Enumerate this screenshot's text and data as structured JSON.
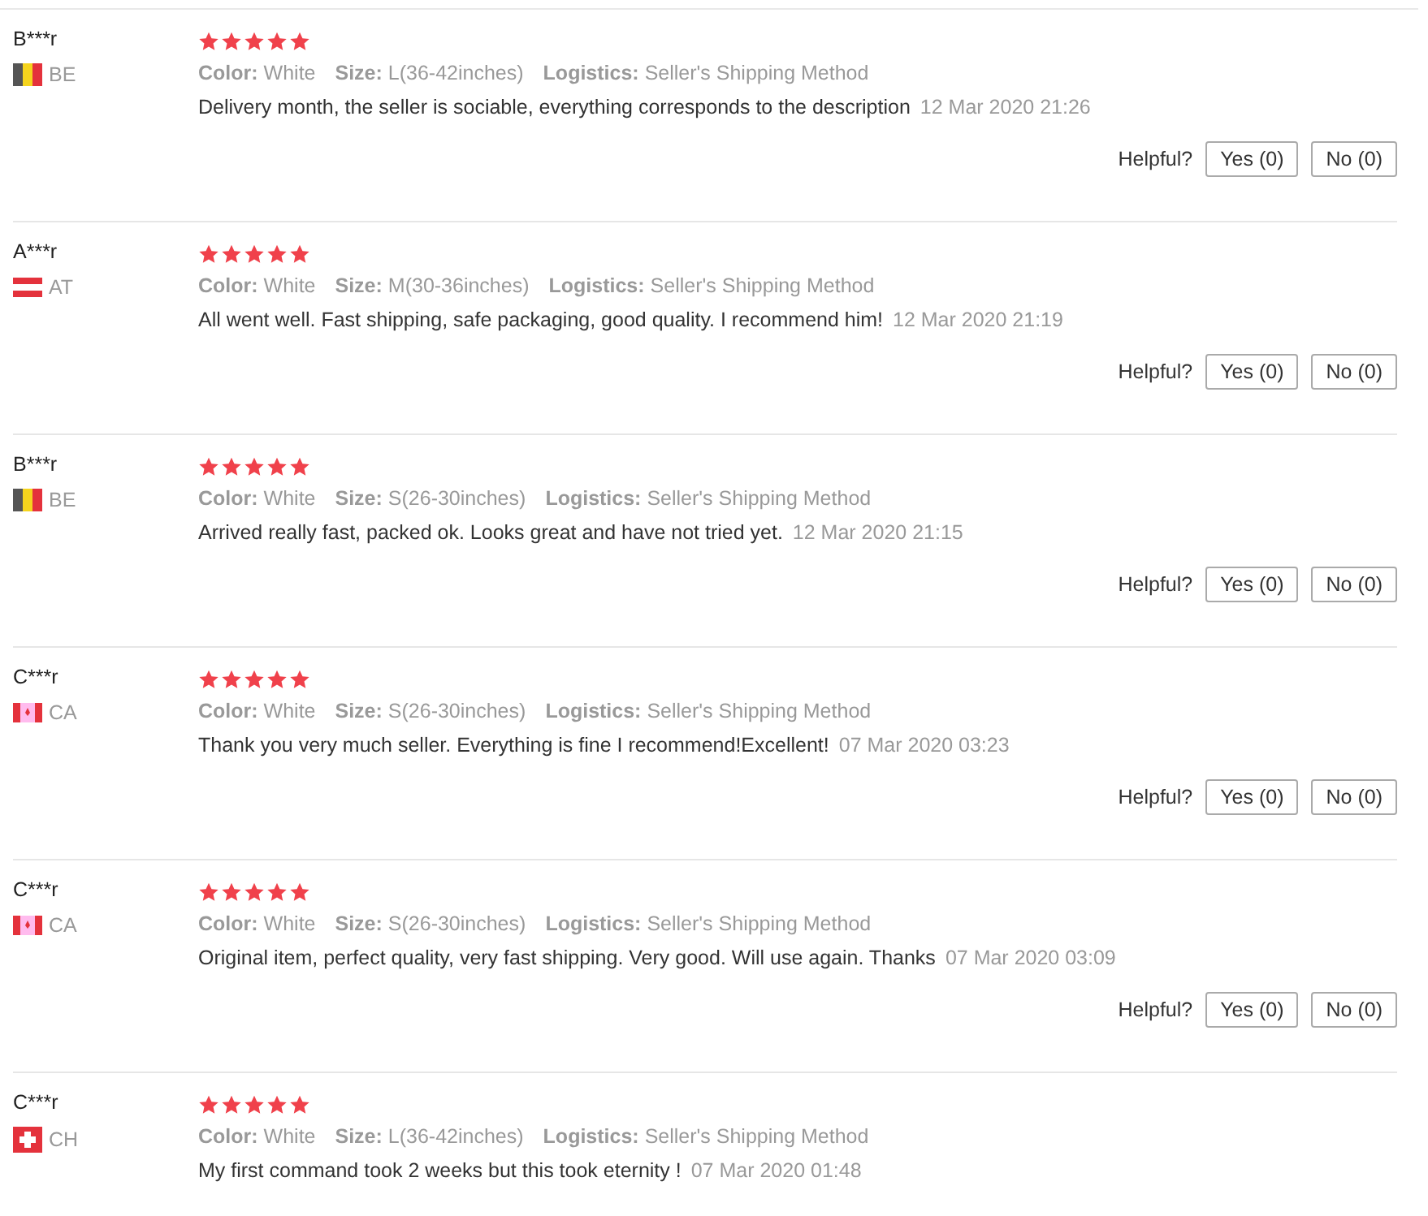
{
  "reviews": [
    {
      "user": "B***r",
      "country": {
        "code": "BE",
        "kind": "belgium"
      },
      "stars": 5,
      "color_label": "Color:",
      "color_value": "White",
      "size_label": "Size:",
      "size": "L(36-42inches)",
      "logistics_label": "Logistics:",
      "logistics": "Seller's Shipping Method",
      "text": "Delivery month, the seller is sociable, everything corresponds to the description",
      "date": "12 Mar 2020 21:26",
      "helpful_label": "Helpful?",
      "yes": "Yes (0)",
      "no": "No (0)"
    },
    {
      "user": "A***r",
      "country": {
        "code": "AT",
        "kind": "austria"
      },
      "stars": 5,
      "color_label": "Color:",
      "color_value": "White",
      "size_label": "Size:",
      "size": "M(30-36inches)",
      "logistics_label": "Logistics:",
      "logistics": "Seller's Shipping Method",
      "text": "All went well. Fast shipping, safe packaging, good quality. I recommend him!",
      "date": "12 Mar 2020 21:19",
      "helpful_label": "Helpful?",
      "yes": "Yes (0)",
      "no": "No (0)"
    },
    {
      "user": "B***r",
      "country": {
        "code": "BE",
        "kind": "belgium"
      },
      "stars": 5,
      "color_label": "Color:",
      "color_value": "White",
      "size_label": "Size:",
      "size": "S(26-30inches)",
      "logistics_label": "Logistics:",
      "logistics": "Seller's Shipping Method",
      "text": "Arrived really fast, packed ok. Looks great and have not tried yet.",
      "date": "12 Mar 2020 21:15",
      "helpful_label": "Helpful?",
      "yes": "Yes (0)",
      "no": "No (0)"
    },
    {
      "user": "C***r",
      "country": {
        "code": "CA",
        "kind": "canada"
      },
      "stars": 5,
      "color_label": "Color:",
      "color_value": "White",
      "size_label": "Size:",
      "size": "S(26-30inches)",
      "logistics_label": "Logistics:",
      "logistics": "Seller's Shipping Method",
      "text": "Thank you very much seller. Everything is fine I recommend!Excellent!",
      "date": "07 Mar 2020 03:23",
      "helpful_label": "Helpful?",
      "yes": "Yes (0)",
      "no": "No (0)"
    },
    {
      "user": "C***r",
      "country": {
        "code": "CA",
        "kind": "canada"
      },
      "stars": 5,
      "color_label": "Color:",
      "color_value": "White",
      "size_label": "Size:",
      "size": "S(26-30inches)",
      "logistics_label": "Logistics:",
      "logistics": "Seller's Shipping Method",
      "text": "Original item, perfect quality, very fast shipping. Very good. Will use again. Thanks",
      "date": "07 Mar 2020 03:09",
      "helpful_label": "Helpful?",
      "yes": "Yes (0)",
      "no": "No (0)"
    },
    {
      "user": "C***r",
      "country": {
        "code": "CH",
        "kind": "switzerland"
      },
      "stars": 5,
      "color_label": "Color:",
      "color_value": "White",
      "size_label": "Size:",
      "size": "L(36-42inches)",
      "logistics_label": "Logistics:",
      "logistics": "Seller's Shipping Method",
      "text": "My first command took 2 weeks but this took eternity !",
      "date": "07 Mar 2020 01:48"
    }
  ]
}
